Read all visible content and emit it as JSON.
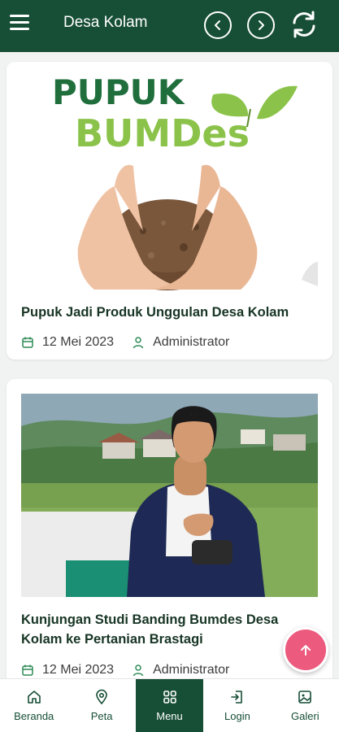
{
  "header": {
    "title": "Desa Kolam",
    "menu_icon": "hamburger-icon",
    "prev_icon": "chevron-left-circle-icon",
    "next_icon": "chevron-right-circle-icon",
    "refresh_icon": "refresh-icon"
  },
  "articles": [
    {
      "image_label_line1": "PUPUK",
      "image_label_line2": "BUMDes",
      "title": "Pupuk Jadi Produk Unggulan Desa Kolam",
      "date": "12 Mei 2023",
      "author": "Administrator"
    },
    {
      "title": "Kunjungan Studi Banding Bumdes Desa Kolam ke Pertanian Brastagi",
      "date": "12 Mei 2023",
      "author": "Administrator"
    }
  ],
  "bottom_nav": [
    {
      "label": "Beranda",
      "icon": "home-icon"
    },
    {
      "label": "Peta",
      "icon": "map-pin-icon"
    },
    {
      "label": "Menu",
      "icon": "grid-icon",
      "active": true
    },
    {
      "label": "Login",
      "icon": "login-icon"
    },
    {
      "label": "Galeri",
      "icon": "gallery-icon"
    }
  ],
  "colors": {
    "primary": "#174e36",
    "fab": "#ec5a7e",
    "logo_green": "#8bc34a"
  }
}
